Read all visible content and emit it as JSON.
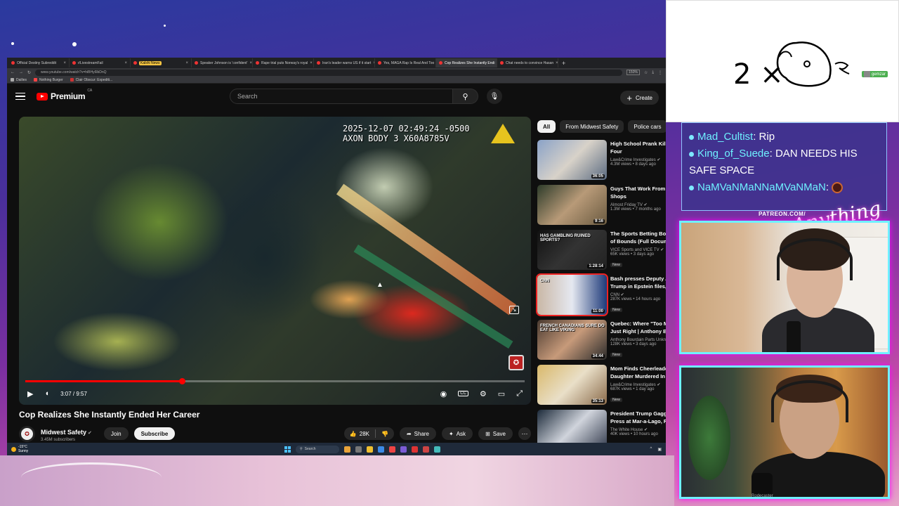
{
  "browser": {
    "tabs": [
      {
        "label": "Official Destiny Subreddit",
        "active": false
      },
      {
        "label": "r/LivestreamFail",
        "active": false
      },
      {
        "label": "Kalshi News",
        "active": false
      },
      {
        "label": "Speaker Johnson is 'confident'",
        "active": false
      },
      {
        "label": "Rape trial puts Norway's royal",
        "active": false
      },
      {
        "label": "Iran's leader warns US if it start",
        "active": false
      },
      {
        "label": "Yes, MAGA Rap Is Real And Too",
        "active": false
      },
      {
        "label": "Cop Realizes She Instantly Endi",
        "active": true
      },
      {
        "label": "Chat needs to convince Hasan",
        "active": false
      }
    ],
    "url": "www.youtube.com/watch?v=hiBHy6lbDnQ",
    "zoom": "150%",
    "bookmarks": [
      "Dailies",
      "Nothing Burger",
      "Clair Obscur: Expediti..."
    ]
  },
  "youtube": {
    "logo_text": "Premium",
    "logo_region": "CA",
    "search_placeholder": "Search",
    "create_label": "Create",
    "video": {
      "timestamp_line1": "2025-12-07 02:49:24 -0500",
      "timestamp_line2": "AXON BODY 3 X60A8785V",
      "current_time": "3:07",
      "duration": "9:57",
      "time_display": "3:07 / 9:57",
      "progress": 0.313,
      "title": "Cop Realizes She Instantly Ended Her Career"
    },
    "channel": {
      "name": "Midwest Safety",
      "subscribers": "3.45M subscribers",
      "join_label": "Join",
      "subscribe_label": "Subscribe"
    },
    "actions": {
      "likes": "28K",
      "share": "Share",
      "ask": "Ask",
      "save": "Save"
    },
    "chips": [
      "All",
      "From Midwest Safety",
      "Police cars",
      "Li"
    ],
    "recommendations": [
      {
        "title1": "High School Prank Kills M",
        "title2": "Four",
        "channel": "Law&Crime Investigates",
        "views": "4.3M views • 8 days ago",
        "duration": "36:05",
        "new": false,
        "thumb": "linear-gradient(135deg,#8aa2c8,#d8d2c9 50%,#5a6a80)",
        "thumb_text": ""
      },
      {
        "title1": "Guys That Work From Cof",
        "title2": "Shops",
        "channel": "Almost Friday TV",
        "views": "1.3M views • 7 months ago",
        "duration": "9:16",
        "new": false,
        "thumb": "linear-gradient(135deg,#2d3b2a,#b89a78 50%,#6a5a40)",
        "thumb_text": ""
      },
      {
        "title1": "The Sports Betting Boom",
        "title2": "of Bounds (Full Document",
        "channel": "VICE Sports and VICE TV",
        "views": "65K views • 3 days ago",
        "duration": "1:28:14",
        "new": true,
        "thumb": "linear-gradient(135deg,#111,#333 50%,#222)",
        "thumb_text": "HAS GAMBLING RUINED SPORTS?"
      },
      {
        "title1": "Bash presses Deputy AG",
        "title2": "Trump in Epstein files, Do",
        "channel": "CNN",
        "views": "287K views • 14 hours ago",
        "duration": "11:00",
        "new": true,
        "thumb": "linear-gradient(90deg,#c9b7a5,#e5e8f0 50%,#1e3a7a)",
        "thumb_text": "CNN"
      },
      {
        "title1": "Quebec: Where \"Too Much",
        "title2": "Just Right | Anthony Bour",
        "channel": "Anthony Bourdain Parts Unkno",
        "views": "128K views • 3 days ago",
        "duration": "34:44",
        "new": true,
        "thumb": "linear-gradient(135deg,#4a3a30,#c79a7a 50%,#2a2a2a)",
        "thumb_text": "FRENCH CANADIANS SURE DO EAT LIKE VIKING"
      },
      {
        "title1": "Mom Finds Cheerleader",
        "title2": "Daughter Murdered In He",
        "channel": "Law&Crime Investigates",
        "views": "687K views • 1 day ago",
        "duration": "35:13",
        "new": true,
        "thumb": "linear-gradient(135deg,#d9b86a,#e9dfc8 50%,#8a6a4a)",
        "thumb_text": ""
      },
      {
        "title1": "President Trump Gaggles",
        "title2": "Press at Mar-a-Lago, Feb.",
        "channel": "The White House",
        "views": "40K views • 10 hours ago",
        "duration": "2:52",
        "new": true,
        "thumb": "linear-gradient(135deg,#1c2a3a,#d0d4dc 50%,#30384a)",
        "thumb_text": ""
      }
    ]
  },
  "taskbar": {
    "weather_temp": "-15°C",
    "weather_desc": "Sunny",
    "search_label": "Search"
  },
  "overlay": {
    "drawing_text": "2 ×",
    "gemzar_label": "gemzar",
    "chat": [
      {
        "user": "Mad_Cultist",
        "text": "Rip"
      },
      {
        "user": "King_of_Suede",
        "text": "DAN NEEDS HIS SAFE SPACE"
      },
      {
        "user": "NaMVaNMaNNaMVaNMaN",
        "text": ""
      }
    ],
    "patreon": "PATREON.COM/",
    "brand_script": "Anything else",
    "mic_label": "Rodecaster"
  }
}
